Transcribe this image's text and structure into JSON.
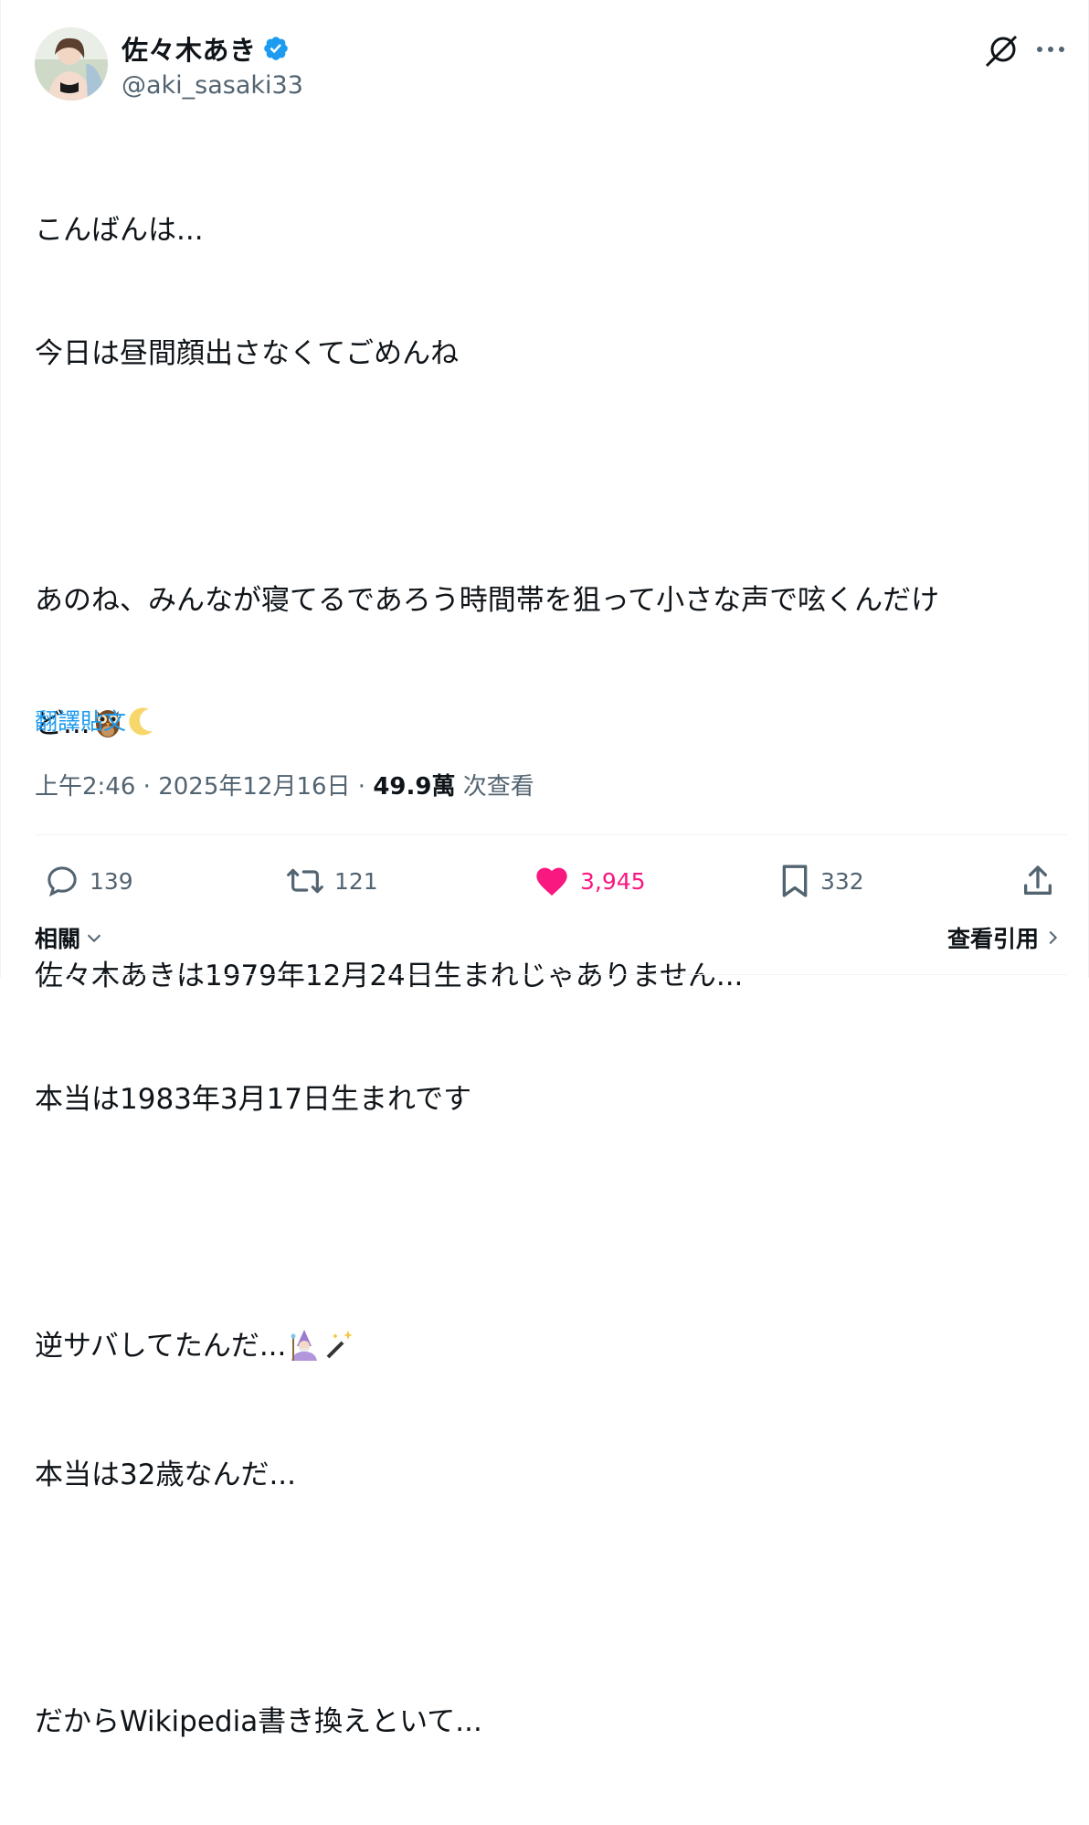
{
  "author": {
    "display_name": "佐々木あき",
    "handle": "@aki_sasaki33",
    "verified": true,
    "avatar_icon": "avatar"
  },
  "tweet": {
    "lines": [
      "こんばんは...",
      "今日は昼間顔出さなくてごめんね",
      "",
      "あのね、みんなが寝てるであろう時間帯を狙って小さな声で呟くんだけ",
      "ど...",
      "",
      "佐々木あきは1979年12月24日生まれじゃありません...",
      "本当は1983年3月17日生まれです",
      "",
      "逆サバしてたんだ...",
      "本当は32歳なんだ...",
      "",
      "だからWikipedia書き換えといて..."
    ],
    "translate_label": "翻譯貼文",
    "time": "上午2:46",
    "date": "2025年12月16日",
    "views_count": "49.9萬",
    "views_label": "次查看"
  },
  "actions": {
    "replies": "139",
    "retweets": "121",
    "likes": "3,945",
    "bookmarks": "332",
    "liked": true
  },
  "footer": {
    "related_label": "相關",
    "quotes_label": "查看引用"
  },
  "colors": {
    "accent": "#1d9bf0",
    "like": "#f91880",
    "text": "#0f1419",
    "secondary": "#536471"
  }
}
